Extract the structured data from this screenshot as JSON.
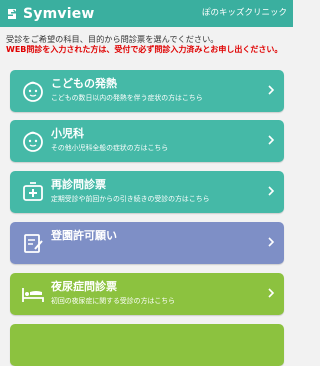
{
  "header": {
    "app_name": "Symview",
    "clinic_name": "ぽのキッズクリニック"
  },
  "intro_text": "受診をご希望の科目、目的から問診票を選んでください。",
  "notice_text": "WEB問診を入力された方は、受付で必ず問診入力済みとお申し出ください。",
  "cards": [
    {
      "title": "こどもの発熱",
      "description": "こどもの数日以内の発熱を伴う症状の方はこちら",
      "icon": "child-face-icon",
      "color": "#45b9a7"
    },
    {
      "title": "小児科",
      "description": "その他小児科全般の症状の方はこちら",
      "icon": "child-face-icon",
      "color": "#45b9a7"
    },
    {
      "title": "再診問診票",
      "description": "定期受診や前回からの引き続きの受診の方はこちら",
      "icon": "medical-cross-icon",
      "color": "#45b9a7"
    },
    {
      "title": "登園許可願い",
      "description": "",
      "icon": "form-edit-icon",
      "color": "#7e8fc6"
    },
    {
      "title": "夜尿症問診票",
      "description": "初回の夜尿症に関する受診の方はこちら",
      "icon": "bed-icon",
      "color": "#8cc23f"
    },
    {
      "title": "",
      "description": "",
      "icon": "",
      "color": "#8cc23f"
    }
  ]
}
